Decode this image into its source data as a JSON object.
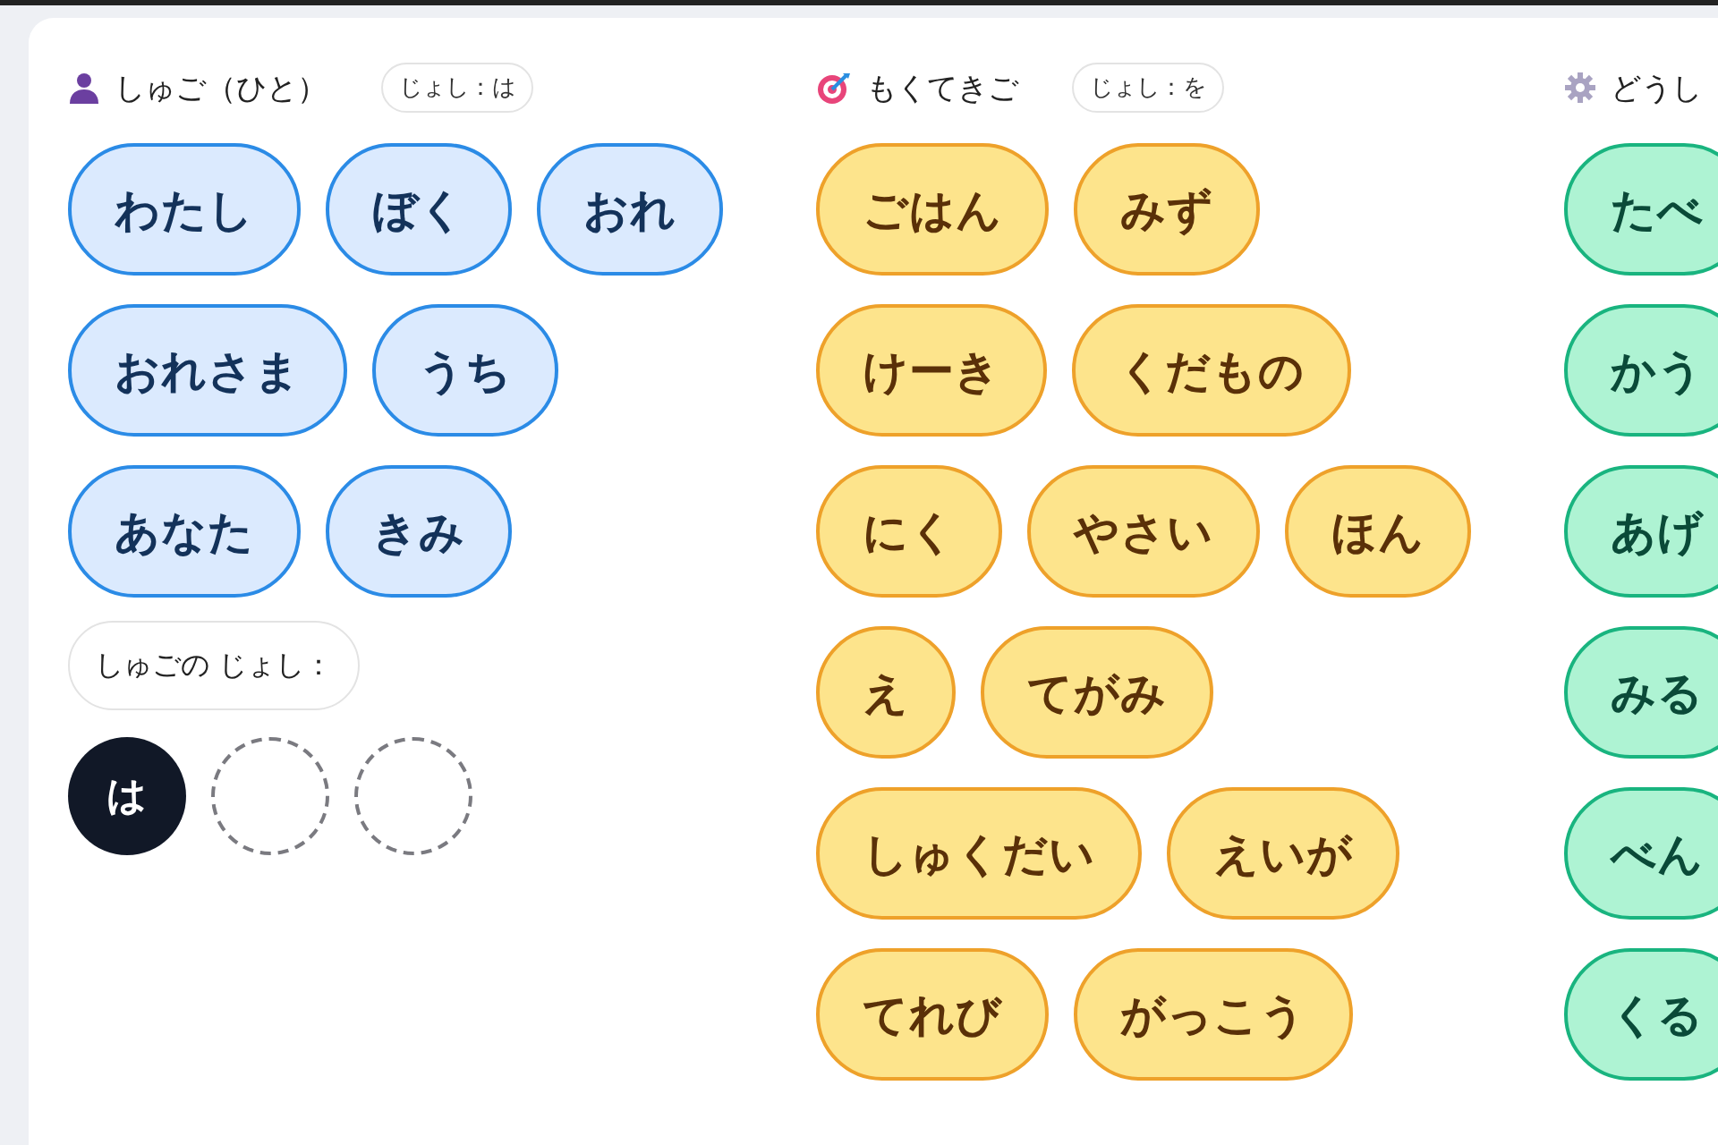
{
  "columns": [
    {
      "kind": "subject",
      "title": "しゅご（ひと）",
      "particle_badge": "じょし：は",
      "rows": [
        [
          "わたし",
          "ぼく",
          "おれ"
        ],
        [
          "おれさま",
          "うち"
        ],
        [
          "あなた",
          "きみ"
        ]
      ],
      "particle_prompt": "しゅごの じょし：",
      "slots": [
        {
          "label": "は",
          "filled": true
        },
        {
          "filled": false
        },
        {
          "filled": false
        }
      ]
    },
    {
      "kind": "object",
      "title": "もくてきご",
      "particle_badge": "じょし：を",
      "rows": [
        [
          "ごはん",
          "みず"
        ],
        [
          "けーき",
          "くだもの"
        ],
        [
          "にく",
          "やさい",
          "ほん"
        ],
        [
          "え",
          "てがみ"
        ],
        [
          "しゅくだい",
          "えいが"
        ],
        [
          "てれび",
          "がっこう"
        ]
      ]
    },
    {
      "kind": "verb",
      "title": "どうし",
      "rows": [
        [
          "たべ"
        ],
        [
          "かう"
        ],
        [
          "あげ"
        ],
        [
          "みる"
        ],
        [
          "べん"
        ],
        [
          "くる"
        ]
      ]
    }
  ]
}
